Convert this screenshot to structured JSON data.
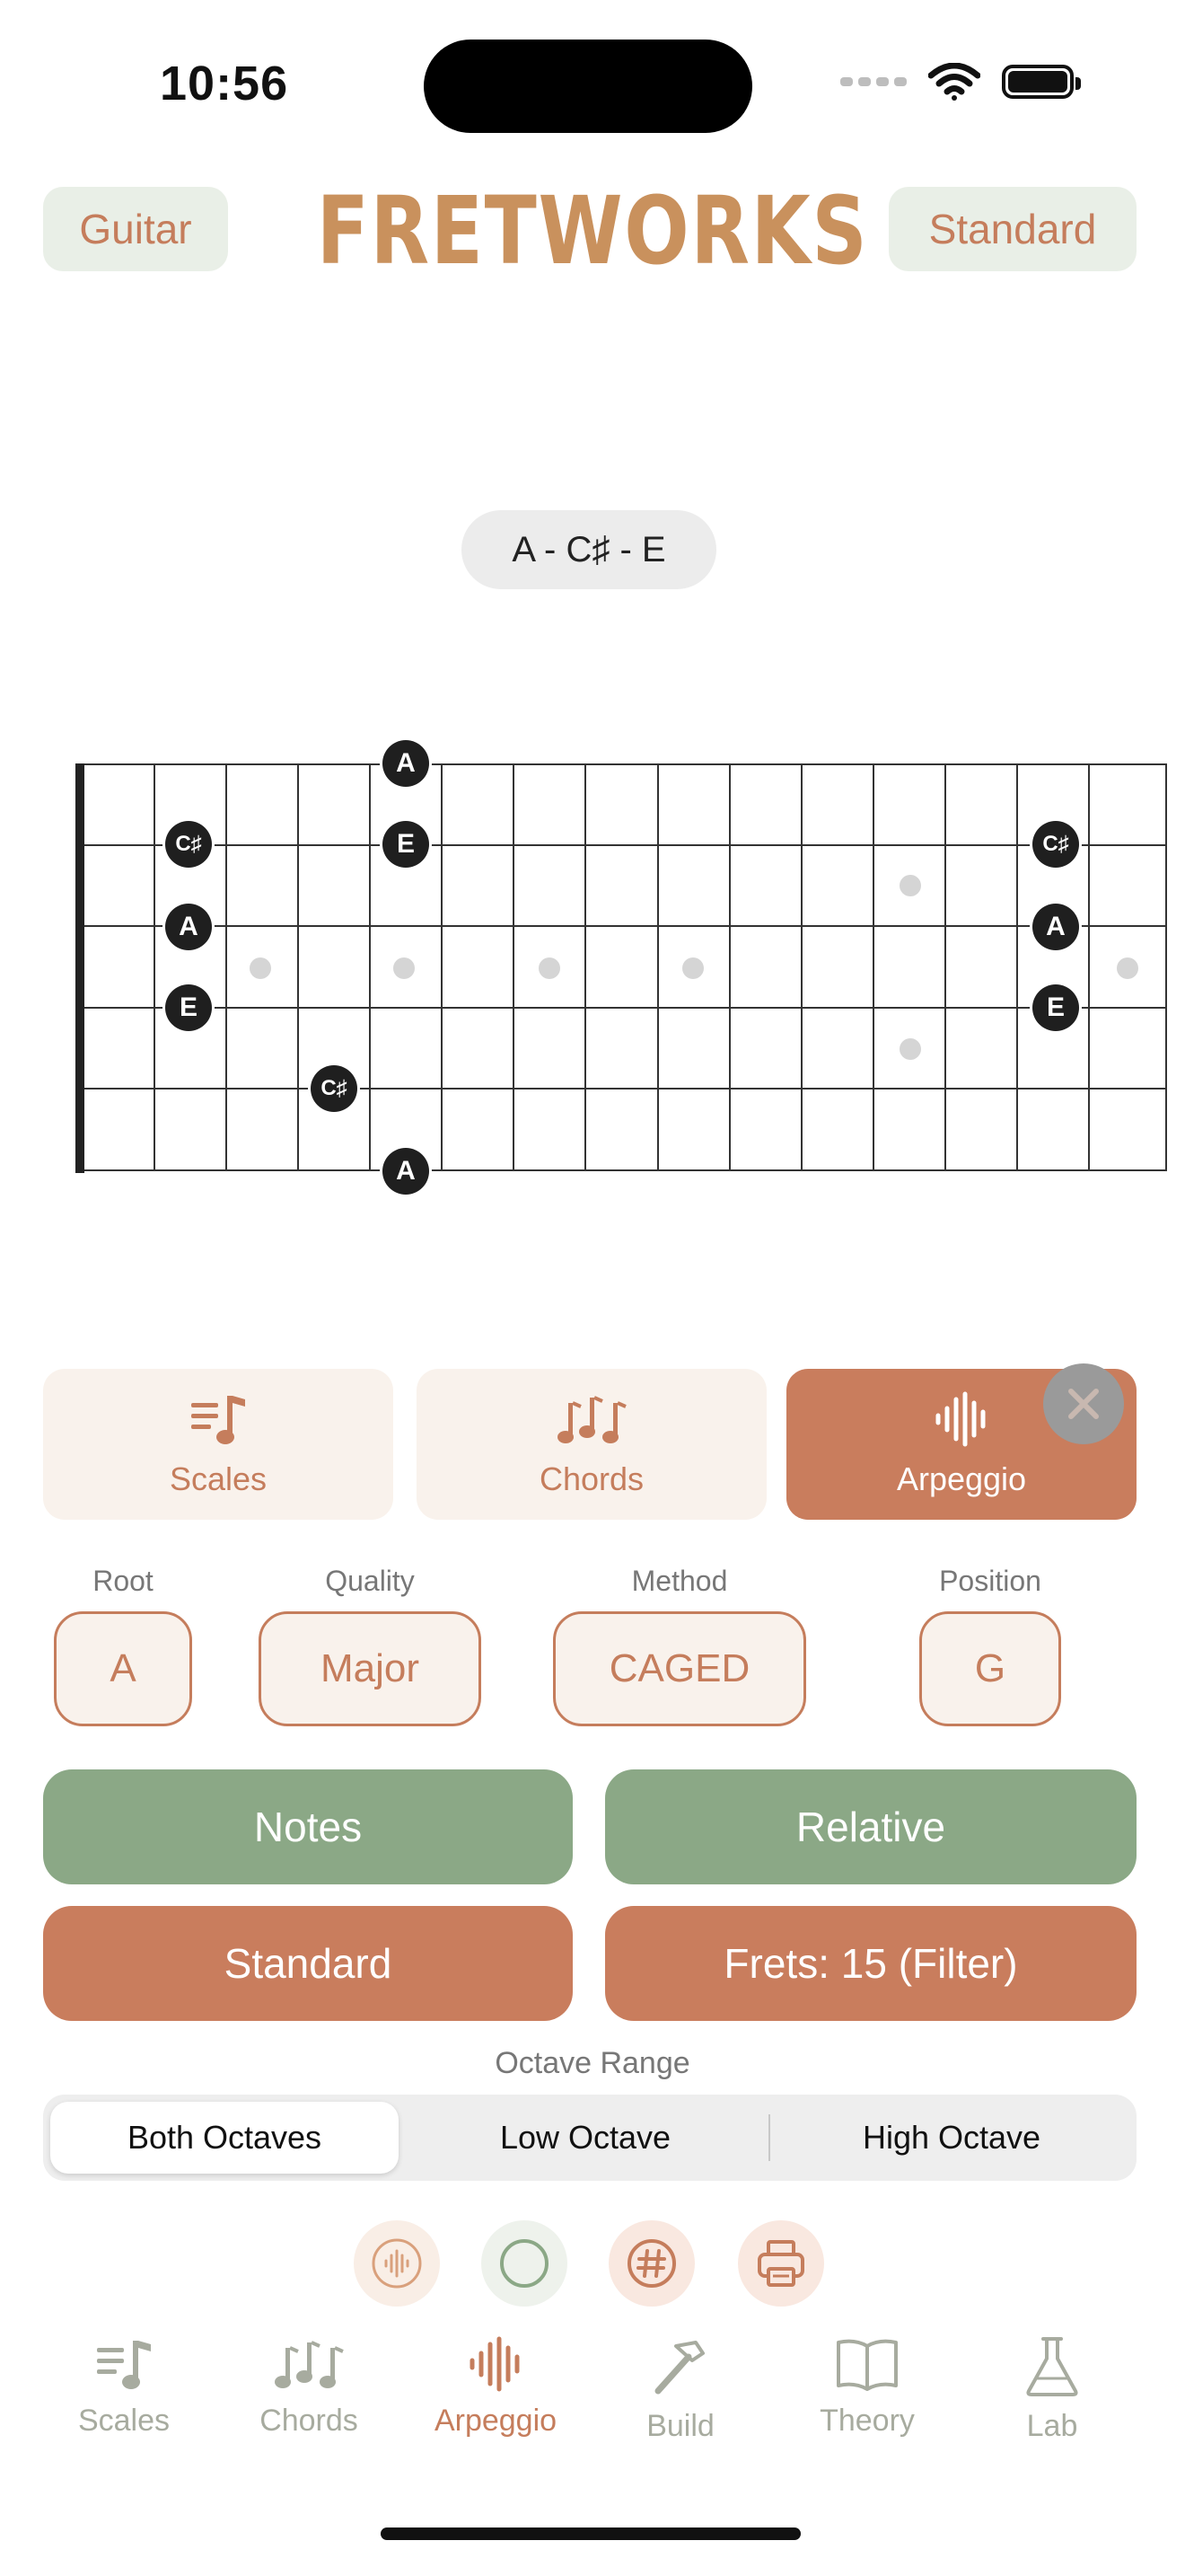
{
  "status": {
    "time": "10:56"
  },
  "header": {
    "instrument": "Guitar",
    "title": "FRETWORKS",
    "tuning": "Standard"
  },
  "chord_notes": "A - C♯ - E",
  "fretboard": {
    "strings": 6,
    "frets": 15,
    "notes": [
      {
        "string": 1,
        "fret": 4,
        "label": "A"
      },
      {
        "string": 2,
        "fret": 2,
        "label": "C♯"
      },
      {
        "string": 2,
        "fret": 4,
        "label": "E"
      },
      {
        "string": 2,
        "fret": 14,
        "label": "C♯"
      },
      {
        "string": 3,
        "fret": 2,
        "label": "A"
      },
      {
        "string": 3,
        "fret": 14,
        "label": "A"
      },
      {
        "string": 4,
        "fret": 2,
        "label": "E"
      },
      {
        "string": 4,
        "fret": 14,
        "label": "E"
      },
      {
        "string": 5,
        "fret": 4,
        "label": "C♯"
      },
      {
        "string": 6,
        "fret": 4,
        "label": "A"
      }
    ]
  },
  "modes": {
    "scales": "Scales",
    "chords": "Chords",
    "arpeggio": "Arpeggio"
  },
  "selectors": {
    "root": {
      "label": "Root",
      "value": "A"
    },
    "quality": {
      "label": "Quality",
      "value": "Major"
    },
    "method": {
      "label": "Method",
      "value": "CAGED"
    },
    "position": {
      "label": "Position",
      "value": "G"
    }
  },
  "buttons": {
    "notes": "Notes",
    "relative": "Relative",
    "standard": "Standard",
    "frets": "Frets: 15 (Filter)"
  },
  "octave": {
    "label": "Octave Range",
    "both": "Both Octaves",
    "low": "Low Octave",
    "high": "High Octave"
  },
  "tabs": {
    "scales": "Scales",
    "chords": "Chords",
    "arpeggio": "Arpeggio",
    "build": "Build",
    "theory": "Theory",
    "lab": "Lab"
  },
  "colors": {
    "accent": "#c57d5c",
    "green": "#8ba886",
    "rust": "#c97d5d",
    "brand": "#c9915d"
  }
}
